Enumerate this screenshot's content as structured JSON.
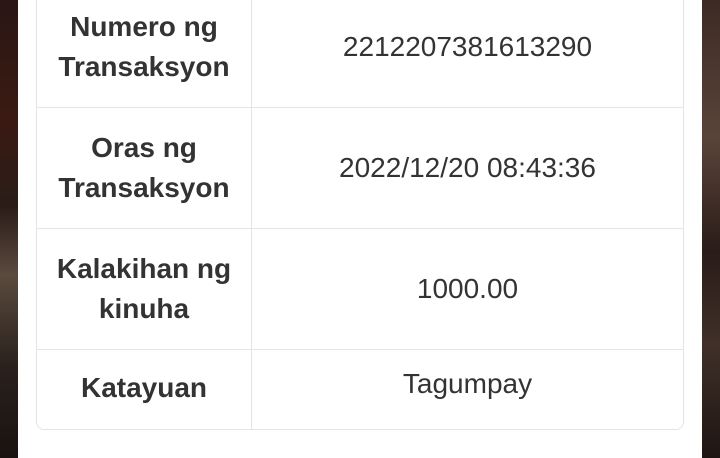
{
  "transaction_details": {
    "rows": [
      {
        "label": "Numero ng Transaksyon",
        "value": "2212207381613290"
      },
      {
        "label": "Oras ng Transaksyon",
        "value": "2022/12/20 08:43:36"
      },
      {
        "label": "Kalakihan ng kinuha",
        "value": "1000.00"
      },
      {
        "label": "Katayuan",
        "value": "Tagumpay"
      }
    ]
  }
}
